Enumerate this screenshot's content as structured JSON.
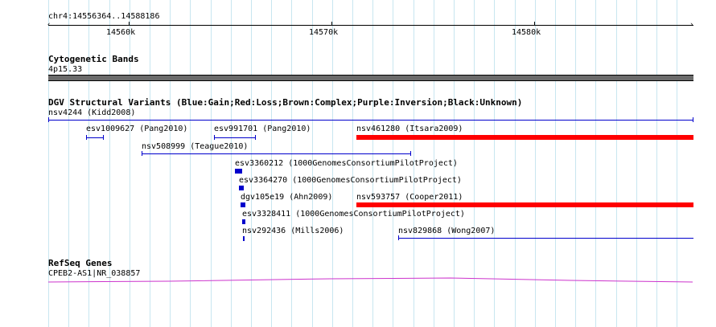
{
  "ruler": {
    "range_label": "chr4:14556364..14588186",
    "ticks": [
      {
        "label": "14560k"
      },
      {
        "label": "14570k"
      },
      {
        "label": "14580k"
      }
    ]
  },
  "cytoband": {
    "title": "Cytogenetic Bands",
    "band_label": "4p15.33",
    "band_color": "#6b6b6b"
  },
  "dgv": {
    "title": "DGV Structural Variants (Blue:Gain;Red:Loss;Brown:Complex;Purple:Inversion;Black:Unknown)",
    "colors": {
      "gain": "#0000cc",
      "loss": "#ff0000"
    },
    "variants": [
      {
        "id": "nsv4244",
        "source": "Kidd2008",
        "label": "nsv4244 (Kidd2008)",
        "type": "gain"
      },
      {
        "id": "esv1009627",
        "source": "Pang2010",
        "label": "esv1009627 (Pang2010)",
        "type": "gain"
      },
      {
        "id": "esv991701",
        "source": "Pang2010",
        "label": "esv991701 (Pang2010)",
        "type": "gain"
      },
      {
        "id": "nsv461280",
        "source": "Itsara2009",
        "label": "nsv461280 (Itsara2009)",
        "type": "loss"
      },
      {
        "id": "nsv508999",
        "source": "Teague2010",
        "label": "nsv508999 (Teague2010)",
        "type": "gain"
      },
      {
        "id": "esv3360212",
        "source": "1000GenomesConsortiumPilotProject",
        "label": "esv3360212 (1000GenomesConsortiumPilotProject)",
        "type": "gain"
      },
      {
        "id": "esv3364270",
        "source": "1000GenomesConsortiumPilotProject",
        "label": "esv3364270 (1000GenomesConsortiumPilotProject)",
        "type": "gain"
      },
      {
        "id": "dgv105e19",
        "source": "Ahn2009",
        "label": "dgv105e19 (Ahn2009)",
        "type": "gain"
      },
      {
        "id": "nsv593757",
        "source": "Cooper2011",
        "label": "nsv593757 (Cooper2011)",
        "type": "loss"
      },
      {
        "id": "esv3328411",
        "source": "1000GenomesConsortiumPilotProject",
        "label": "esv3328411 (1000GenomesConsortiumPilotProject)",
        "type": "gain"
      },
      {
        "id": "nsv292436",
        "source": "Mills2006",
        "label": "nsv292436 (Mills2006)",
        "type": "gain"
      },
      {
        "id": "nsv829868",
        "source": "Wong2007",
        "label": "nsv829868 (Wong2007)",
        "type": "gain"
      }
    ]
  },
  "refseq": {
    "title": "RefSeq Genes",
    "gene_label": "CPEB2-AS1|NR_038857",
    "gene_color": "#cc33cc"
  }
}
